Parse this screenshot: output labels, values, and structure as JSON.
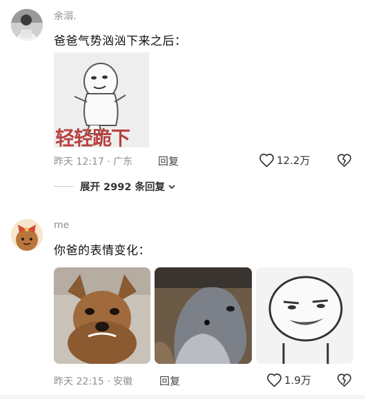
{
  "comments": [
    {
      "username": "余溺.",
      "text": "爸爸气势汹汹下来之后：",
      "meme_caption": "轻轻跪下",
      "time": "昨天 12:17",
      "location": "· 广东",
      "reply_label": "回复",
      "likes": "12.2万",
      "expand_label": "展开 2992 条回复"
    },
    {
      "username": "me",
      "text": "你爸的表情变化：",
      "time": "昨天 22:15",
      "location": "· 安徽",
      "reply_label": "回复",
      "likes": "1.9万"
    }
  ],
  "colors": {
    "meta_gray": "#8e8e8e",
    "text": "#111111",
    "meme_caption": "#b7413f"
  },
  "icons": [
    "heart-icon",
    "broken-heart-icon",
    "chevron-down-icon"
  ]
}
